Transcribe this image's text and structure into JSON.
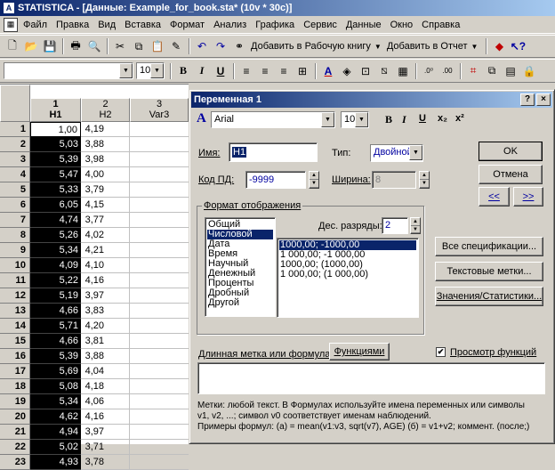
{
  "app": {
    "title": "STATISTICA - [Данные: Example_for_book.sta* (10v * 30c)]",
    "icon": "A"
  },
  "menu": [
    "Файл",
    "Правка",
    "Вид",
    "Вставка",
    "Формат",
    "Анализ",
    "Графика",
    "Сервис",
    "Данные",
    "Окно",
    "Справка"
  ],
  "toolbar": {
    "add_workbook": "Добавить в Рабочую книгу",
    "add_report": "Добавить в Отчет",
    "font_size": "10"
  },
  "grid": {
    "columns": [
      {
        "num": "1",
        "name": "H1"
      },
      {
        "num": "2",
        "name": "H2"
      },
      {
        "num": "3",
        "name": "Var3"
      }
    ],
    "rows": [
      [
        "1",
        "1,00",
        "4,19"
      ],
      [
        "2",
        "5,03",
        "3,88"
      ],
      [
        "3",
        "5,39",
        "3,98"
      ],
      [
        "4",
        "5,47",
        "4,00"
      ],
      [
        "5",
        "5,33",
        "3,79"
      ],
      [
        "6",
        "6,05",
        "4,15"
      ],
      [
        "7",
        "4,74",
        "3,77"
      ],
      [
        "8",
        "5,26",
        "4,02"
      ],
      [
        "9",
        "5,34",
        "4,21"
      ],
      [
        "10",
        "4,09",
        "4,10"
      ],
      [
        "11",
        "5,22",
        "4,16"
      ],
      [
        "12",
        "5,19",
        "3,97"
      ],
      [
        "13",
        "4,66",
        "3,83"
      ],
      [
        "14",
        "5,71",
        "4,20"
      ],
      [
        "15",
        "4,66",
        "3,81"
      ],
      [
        "16",
        "5,39",
        "3,88"
      ],
      [
        "17",
        "5,69",
        "4,04"
      ],
      [
        "18",
        "5,08",
        "4,18"
      ],
      [
        "19",
        "5,34",
        "4,06"
      ],
      [
        "20",
        "4,62",
        "4,16"
      ],
      [
        "21",
        "4,94",
        "3,97"
      ],
      [
        "22",
        "5,02",
        "3,71"
      ],
      [
        "23",
        "4,93",
        "3,78"
      ]
    ]
  },
  "dialog": {
    "title": "Переменная 1",
    "help": "?",
    "close": "×",
    "font_name": "Arial",
    "font_size": "10",
    "fmt_buttons": [
      "B",
      "I",
      "U",
      "x₂",
      "x²"
    ],
    "name_label": "Имя:",
    "name_value": "H1",
    "type_label": "Тип:",
    "type_value": "Двойной",
    "md_label": "Код ПД:",
    "md_value": "-9999",
    "width_label": "Ширина:",
    "width_value": "8",
    "ok": "OK",
    "cancel": "Отмена",
    "prev": "<<",
    "next": ">>",
    "format_group": "Формат отображения",
    "formats": [
      "Общий",
      "Числовой",
      "Дата",
      "Время",
      "Научный",
      "Денежный",
      "Проценты",
      "Дробный",
      "Другой"
    ],
    "decimals_label": "Дес. разряды:",
    "decimals_value": "2",
    "patterns": [
      "1000,00; -1000,00",
      "1 000,00; -1 000,00",
      "1000,00; (1000,00)",
      "1 000,00; (1 000,00)"
    ],
    "all_specs": "Все спецификации...",
    "text_labels": "Текстовые метки...",
    "values_stats": "Значения/Статистики...",
    "long_label": "Длинная метка или формула с",
    "functions": "Функциями",
    "preview": "Просмотр функций",
    "hint1": "Метки: любой текст.    В Формулах используйте имена переменных или символы",
    "hint2": "v1, v2, ...; символ v0 соответствует именам наблюдений.",
    "hint3": "Примеры формул:  (a) = mean(v1:v3, sqrt(v7), AGE)  (б) = v1+v2; коммент. (после;)"
  }
}
